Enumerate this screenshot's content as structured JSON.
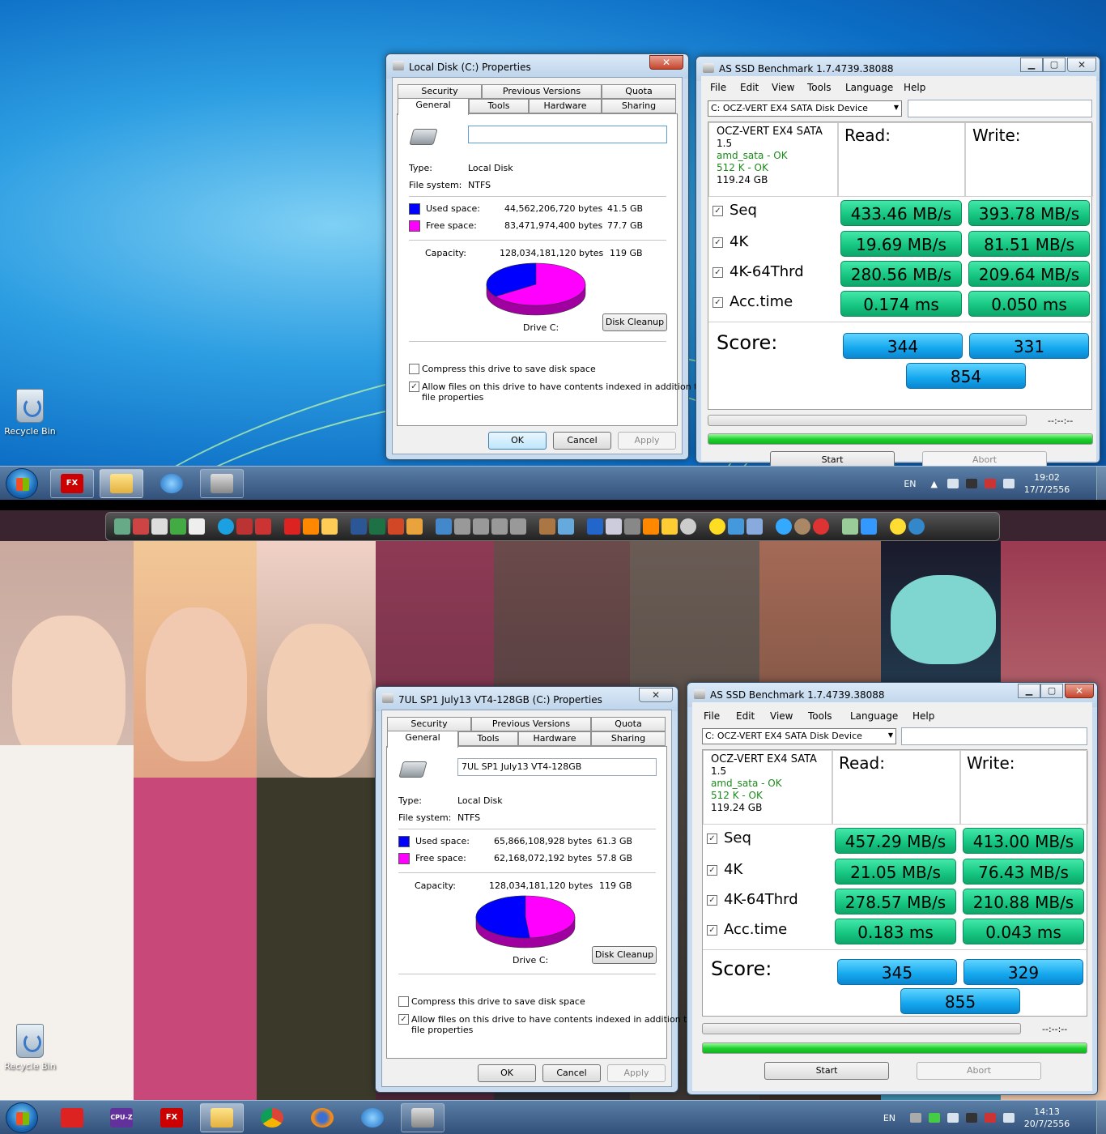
{
  "screens": [
    {
      "desktop": {
        "recycle_bin": "Recycle Bin"
      },
      "properties": {
        "title": "Local Disk (C:) Properties",
        "close": "✕",
        "tabs_top": [
          "Security",
          "Previous Versions",
          "Quota"
        ],
        "tabs_bottom": [
          "General",
          "Tools",
          "Hardware",
          "Sharing"
        ],
        "name_value": "",
        "type_label": "Type:",
        "type_value": "Local Disk",
        "fs_label": "File system:",
        "fs_value": "NTFS",
        "used_label": "Used space:",
        "used_bytes": "44,562,206,720 bytes",
        "used_gb": "41.5 GB",
        "free_label": "Free space:",
        "free_bytes": "83,471,974,400 bytes",
        "free_gb": "77.7 GB",
        "cap_label": "Capacity:",
        "cap_bytes": "128,034,181,120 bytes",
        "cap_gb": "119 GB",
        "drive_label": "Drive C:",
        "cleanup": "Disk Cleanup",
        "compress": "Compress this drive to save disk space",
        "index_line1": "Allow files on this drive to have contents indexed in addition to",
        "index_line2": "file properties",
        "ok": "OK",
        "cancel": "Cancel",
        "apply": "Apply",
        "used_fraction": 0.348
      },
      "asssd": {
        "title": "AS SSD Benchmark 1.7.4739.38088",
        "menu": [
          "File",
          "Edit",
          "View",
          "Tools",
          "Language",
          "Help"
        ],
        "device": "C: OCZ-VERT EX4 SATA Disk Device",
        "info": {
          "name": "OCZ-VERT EX4 SATA",
          "fw": "1.5",
          "driver": "amd_sata - OK",
          "align": "512 K - OK",
          "size": "119.24 GB"
        },
        "read_hdr": "Read:",
        "write_hdr": "Write:",
        "tests": [
          {
            "label": "Seq",
            "read": "433.46 MB/s",
            "write": "393.78 MB/s"
          },
          {
            "label": "4K",
            "read": "19.69 MB/s",
            "write": "81.51 MB/s"
          },
          {
            "label": "4K-64Thrd",
            "read": "280.56 MB/s",
            "write": "209.64 MB/s"
          },
          {
            "label": "Acc.time",
            "read": "0.174 ms",
            "write": "0.050 ms"
          }
        ],
        "score_label": "Score:",
        "score_read": "344",
        "score_write": "331",
        "score_total": "854",
        "time": "--:--:--",
        "start": "Start",
        "abort": "Abort"
      },
      "taskbar": {
        "lang": "EN",
        "time": "19:02",
        "date": "17/7/2556",
        "fx_label": "FX"
      }
    },
    {
      "desktop": {
        "recycle_bin": "Recycle Bin"
      },
      "properties": {
        "title": "7UL SP1 July13 VT4-128GB (C:) Properties",
        "close": "✕",
        "tabs_top": [
          "Security",
          "Previous Versions",
          "Quota"
        ],
        "tabs_bottom": [
          "General",
          "Tools",
          "Hardware",
          "Sharing"
        ],
        "name_value": "7UL SP1 July13 VT4-128GB",
        "type_label": "Type:",
        "type_value": "Local Disk",
        "fs_label": "File system:",
        "fs_value": "NTFS",
        "used_label": "Used space:",
        "used_bytes": "65,866,108,928 bytes",
        "used_gb": "61.3 GB",
        "free_label": "Free space:",
        "free_bytes": "62,168,072,192 bytes",
        "free_gb": "57.8 GB",
        "cap_label": "Capacity:",
        "cap_bytes": "128,034,181,120 bytes",
        "cap_gb": "119 GB",
        "drive_label": "Drive C:",
        "cleanup": "Disk Cleanup",
        "compress": "Compress this drive to save disk space",
        "index_line1": "Allow files on this drive to have contents indexed in addition to",
        "index_line2": "file properties",
        "ok": "OK",
        "cancel": "Cancel",
        "apply": "Apply",
        "used_fraction": 0.514
      },
      "asssd": {
        "title": "AS SSD Benchmark 1.7.4739.38088",
        "menu": [
          "File",
          "Edit",
          "View",
          "Tools",
          "Language",
          "Help"
        ],
        "device": "C: OCZ-VERT EX4 SATA Disk Device",
        "info": {
          "name": "OCZ-VERT EX4 SATA",
          "fw": "1.5",
          "driver": "amd_sata - OK",
          "align": "512 K - OK",
          "size": "119.24 GB"
        },
        "read_hdr": "Read:",
        "write_hdr": "Write:",
        "tests": [
          {
            "label": "Seq",
            "read": "457.29 MB/s",
            "write": "413.00 MB/s"
          },
          {
            "label": "4K",
            "read": "21.05 MB/s",
            "write": "76.43 MB/s"
          },
          {
            "label": "4K-64Thrd",
            "read": "278.57 MB/s",
            "write": "210.88 MB/s"
          },
          {
            "label": "Acc.time",
            "read": "0.183 ms",
            "write": "0.043 ms"
          }
        ],
        "score_label": "Score:",
        "score_read": "345",
        "score_write": "329",
        "score_total": "855",
        "time": "--:--:--",
        "start": "Start",
        "abort": "Abort"
      },
      "taskbar": {
        "lang": "EN",
        "time": "14:13",
        "date": "20/7/2556",
        "fx_label": "FX",
        "cpuz_label": "CPU-Z"
      }
    }
  ],
  "colors": {
    "used": "#0000ff",
    "free": "#ff00ff",
    "read_green": "#14c47f",
    "score_blue": "#14a7ee"
  }
}
